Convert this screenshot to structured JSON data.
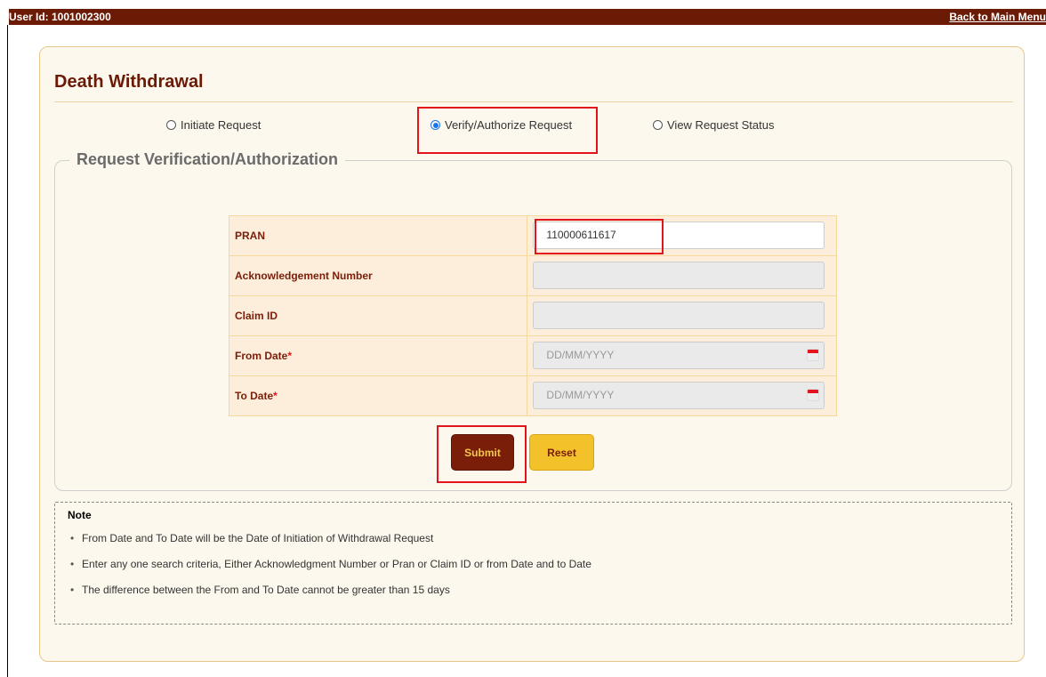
{
  "header": {
    "user_id": "User Id: 1001002300",
    "back_link": "Back to Main Menu"
  },
  "page": {
    "title": "Death Withdrawal"
  },
  "radio_options": [
    {
      "label": "Initiate Request",
      "checked": false
    },
    {
      "label": "Verify/Authorize Request",
      "checked": true
    },
    {
      "label": "View Request Status",
      "checked": false
    }
  ],
  "section": {
    "legend": "Request Verification/Authorization"
  },
  "form": {
    "pran_label": "PRAN",
    "pran_value": "110000611617",
    "ack_label": "Acknowledgement Number",
    "ack_value": "",
    "claim_label": "Claim ID",
    "claim_value": "",
    "from_label": "From Date",
    "from_placeholder": "DD/MM/YYYY",
    "to_label": "To Date",
    "to_placeholder": "DD/MM/YYYY",
    "required_mark": "*"
  },
  "buttons": {
    "submit": "Submit",
    "reset": "Reset"
  },
  "note": {
    "heading": "Note",
    "items": [
      "From Date and To Date will be the Date of Initiation of Withdrawal Request",
      "Enter any one search criteria, Either Acknowledgment Number or Pran or Claim ID or from Date and to Date",
      "The difference between the From and To Date cannot be greater than 15 days"
    ]
  },
  "colors": {
    "header_bar": "#6b1a06",
    "accent_maroon": "#7a1e0a",
    "accent_gold": "#f3c22b",
    "highlight_red": "#e3141b",
    "radio_selected": "#1a73e8"
  },
  "icons": {
    "calendar": "calendar-icon"
  }
}
